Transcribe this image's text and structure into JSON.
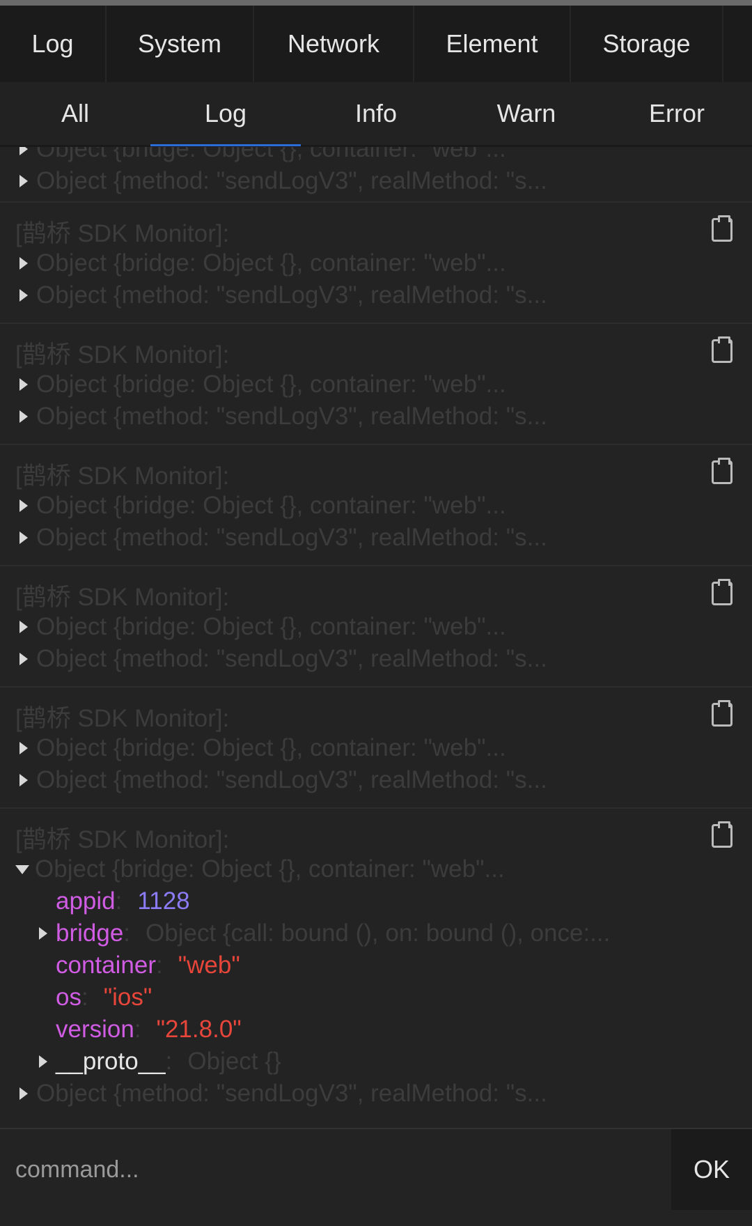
{
  "main_tabs": [
    {
      "label": "Log",
      "width": 153
    },
    {
      "label": "System",
      "width": 212
    },
    {
      "label": "Network",
      "width": 230
    },
    {
      "label": "Element",
      "width": 225
    },
    {
      "label": "Storage",
      "width": 219
    }
  ],
  "sub_tabs": {
    "items": [
      "All",
      "Log",
      "Info",
      "Warn",
      "Error"
    ],
    "active": "Log"
  },
  "partial_entry": {
    "lines": [
      "Object {bridge: Object {}, container: \"web\"...",
      "Object {method: \"sendLogV3\", realMethod: \"s..."
    ]
  },
  "entries": [
    {
      "header": "[鹊桥 SDK Monitor]:",
      "line1": "Object {bridge: Object {}, container: \"web\"...",
      "line2": "Object {method: \"sendLogV3\", realMethod: \"s..."
    },
    {
      "header": "[鹊桥 SDK Monitor]:",
      "line1": "Object {bridge: Object {}, container: \"web\"...",
      "line2": "Object {method: \"sendLogV3\", realMethod: \"s..."
    },
    {
      "header": "[鹊桥 SDK Monitor]:",
      "line1": "Object {bridge: Object {}, container: \"web\"...",
      "line2": "Object {method: \"sendLogV3\", realMethod: \"s..."
    },
    {
      "header": "[鹊桥 SDK Monitor]:",
      "line1": "Object {bridge: Object {}, container: \"web\"...",
      "line2": "Object {method: \"sendLogV3\", realMethod: \"s..."
    },
    {
      "header": "[鹊桥 SDK Monitor]:",
      "line1": "Object {bridge: Object {}, container: \"web\"...",
      "line2": "Object {method: \"sendLogV3\", realMethod: \"s..."
    }
  ],
  "expanded_entry": {
    "header": "[鹊桥 SDK Monitor]:",
    "object_summary": "Object {bridge: Object {}, container: \"web\"...",
    "props": {
      "appid": {
        "key": "appid",
        "value": "1128"
      },
      "bridge": {
        "key": "bridge",
        "value": "Object {call: bound (), on: bound (), once:..."
      },
      "container": {
        "key": "container",
        "value": "\"web\""
      },
      "os": {
        "key": "os",
        "value": "\"ios\""
      },
      "version": {
        "key": "version",
        "value": "\"21.8.0\""
      },
      "proto": {
        "key": "__proto__",
        "value": "Object {}"
      }
    },
    "colon": ":",
    "second_line": "Object {method: \"sendLogV3\", realMethod: \"s..."
  },
  "command": {
    "placeholder": "command...",
    "ok_label": "OK"
  },
  "colors": {
    "background": "#222222",
    "active_tab_underline": "#2a6dd8",
    "key": "#d05ce3",
    "number": "#8b7cf6",
    "string": "#e8463b"
  }
}
